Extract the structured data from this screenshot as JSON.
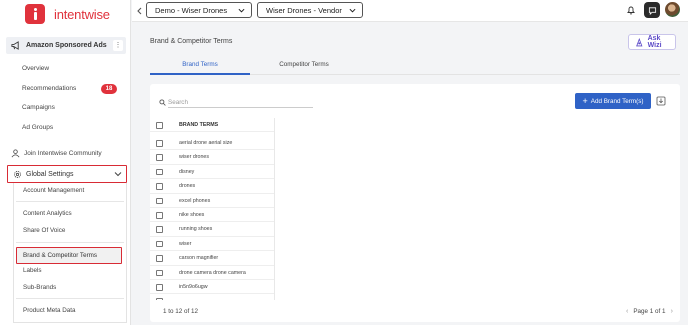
{
  "brand": {
    "name": "intentwise"
  },
  "sidebar": {
    "section": {
      "label": "Amazon Sponsored Ads"
    },
    "items": [
      {
        "label": "Overview"
      },
      {
        "label": "Recommendations",
        "badge": "18"
      },
      {
        "label": "Campaigns"
      },
      {
        "label": "Ad Groups"
      }
    ],
    "community": "Join Intentwise Community",
    "global_settings": {
      "label": "Global Settings",
      "items": [
        {
          "label": "Account Management"
        },
        {
          "label": "Content Analytics"
        },
        {
          "label": "Share Of Voice"
        },
        {
          "label": "Brand & Competitor Terms"
        },
        {
          "label": "Labels"
        },
        {
          "label": "Sub-Brands"
        },
        {
          "label": "Product Meta Data"
        }
      ]
    }
  },
  "topbar": {
    "account_select": "Demo - Wiser Drones",
    "profile_select": "Wiser Drones - Vendor"
  },
  "page": {
    "title": "Brand & Competitor Terms",
    "ask_wizi": "Ask Wizi",
    "tabs": [
      {
        "label": "Brand Terms",
        "active": true
      },
      {
        "label": "Competitor Terms",
        "active": false
      }
    ],
    "search_placeholder": "Search",
    "add_button": "Add Brand Term(s)",
    "table": {
      "header": "BRAND TERMS",
      "rows": [
        "aerial drone aerial size",
        "wiser drones",
        "disney",
        "drones",
        "excel phones",
        "nike shoes",
        "running shoes",
        "wiser",
        "carson magnifier",
        "drone camera drone camera",
        "in5n9o6ugw"
      ]
    },
    "footer": {
      "count": "1 to 12 of 12",
      "page": "Page 1 of 1"
    }
  },
  "colors": {
    "accent": "#2f62c6",
    "brand_red": "#e0323c",
    "wizi_purple": "#5b49c7"
  }
}
